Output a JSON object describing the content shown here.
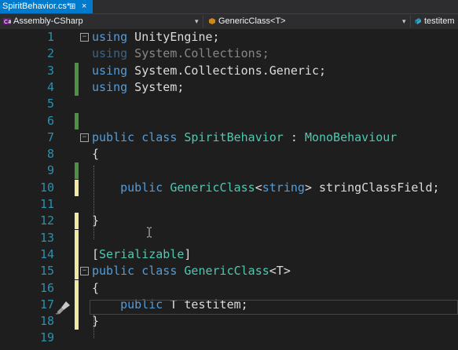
{
  "tab": {
    "title": "SpiritBehavior.cs*",
    "pin_glyph": "⊞",
    "close_glyph": "×"
  },
  "navbar": {
    "project": "Assembly-CSharp",
    "class": "GenericClass<T>",
    "member": "testitem",
    "dropdown_glyph": "▾"
  },
  "colors": {
    "keyword": "#569cd6",
    "type": "#4ec9b0",
    "line_number": "#2b91af",
    "text": "#dcdcdc",
    "change_saved": "#57a64a",
    "change_unsaved": "#efe9a2"
  },
  "icons": {
    "quick_actions": "paintbrush-icon",
    "cursor": "ibeam-cursor-icon"
  },
  "lines": [
    {
      "n": "1",
      "change": "",
      "fold": "−",
      "tokens": [
        [
          "kw",
          "using"
        ],
        [
          "pl",
          " UnityEngine;"
        ]
      ]
    },
    {
      "n": "2",
      "change": "",
      "fold": "",
      "tokens": [
        [
          "kwd",
          "using"
        ],
        [
          "dim",
          " System.Collections;"
        ]
      ]
    },
    {
      "n": "3",
      "change": "green",
      "fold": "",
      "tokens": [
        [
          "kw",
          "using"
        ],
        [
          "pl",
          " System.Collections.Generic;"
        ]
      ]
    },
    {
      "n": "4",
      "change": "green",
      "fold": "",
      "tokens": [
        [
          "kw",
          "using"
        ],
        [
          "pl",
          " System;"
        ]
      ]
    },
    {
      "n": "5",
      "change": "",
      "fold": "",
      "tokens": []
    },
    {
      "n": "6",
      "change": "green",
      "fold": "",
      "tokens": []
    },
    {
      "n": "7",
      "change": "",
      "fold": "−",
      "tokens": [
        [
          "kw",
          "public"
        ],
        [
          "pl",
          " "
        ],
        [
          "kw",
          "class"
        ],
        [
          "pl",
          " "
        ],
        [
          "ty",
          "SpiritBehavior"
        ],
        [
          "pl",
          " : "
        ],
        [
          "ty",
          "MonoBehaviour"
        ]
      ]
    },
    {
      "n": "8",
      "change": "",
      "fold": "",
      "tokens": [
        [
          "pl",
          "{"
        ]
      ]
    },
    {
      "n": "9",
      "change": "green",
      "fold": "",
      "tokens": []
    },
    {
      "n": "10",
      "change": "yellow",
      "fold": "",
      "tokens": [
        [
          "pl",
          "    "
        ],
        [
          "kw",
          "public"
        ],
        [
          "pl",
          " "
        ],
        [
          "ty",
          "GenericClass"
        ],
        [
          "pl",
          "<"
        ],
        [
          "kw",
          "string"
        ],
        [
          "pl",
          "> stringClassField;"
        ]
      ]
    },
    {
      "n": "11",
      "change": "",
      "fold": "",
      "tokens": []
    },
    {
      "n": "12",
      "change": "yellow",
      "fold": "",
      "tokens": [
        [
          "pl",
          "}"
        ]
      ]
    },
    {
      "n": "13",
      "change": "yellow",
      "fold": "",
      "tokens": []
    },
    {
      "n": "14",
      "change": "yellow",
      "fold": "",
      "tokens": [
        [
          "pl",
          "["
        ],
        [
          "ty",
          "Serializable"
        ],
        [
          "pl",
          "]"
        ]
      ]
    },
    {
      "n": "15",
      "change": "yellow",
      "fold": "−",
      "tokens": [
        [
          "kw",
          "public"
        ],
        [
          "pl",
          " "
        ],
        [
          "kw",
          "class"
        ],
        [
          "pl",
          " "
        ],
        [
          "ty",
          "GenericClass"
        ],
        [
          "pl",
          "<T>"
        ]
      ]
    },
    {
      "n": "16",
      "change": "yellow",
      "fold": "",
      "tokens": [
        [
          "pl",
          "{"
        ]
      ]
    },
    {
      "n": "17",
      "change": "yellow",
      "fold": "",
      "tokens": [
        [
          "pl",
          "    "
        ],
        [
          "kw",
          "public"
        ],
        [
          "pl",
          " T testitem;"
        ]
      ]
    },
    {
      "n": "18",
      "change": "yellow",
      "fold": "",
      "tokens": [
        [
          "pl",
          "}"
        ]
      ]
    },
    {
      "n": "19",
      "change": "",
      "fold": "",
      "tokens": []
    }
  ]
}
